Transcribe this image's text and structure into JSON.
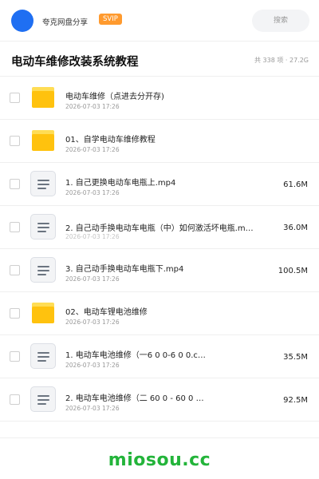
{
  "header": {
    "username": "夸克网盘分享",
    "badge": "SVIP",
    "search_placeholder": "搜索"
  },
  "page": {
    "title": "电动车维修改装系统教程",
    "meta": "共 338 项 · 27.2G"
  },
  "files": [
    {
      "type": "folder",
      "name": "电动车维修（点进去分开存)",
      "date": "2026-07-03 17:26",
      "size": ""
    },
    {
      "type": "folder",
      "name": "01、自学电动车维修教程",
      "date": "2026-07-03 17:26",
      "size": ""
    },
    {
      "type": "video",
      "name": "1. 自己更换电动车电瓶上.mp4",
      "date": "2026-07-03 17:26",
      "size": "61.6M"
    },
    {
      "type": "video",
      "name": "2. 自己动手换电动车电瓶（中）如何激活坏电瓶.m…",
      "date": "2026-07-03 17:26",
      "size": "36.0M"
    },
    {
      "type": "video",
      "name": "3. 自己动手换电动车电瓶下.mp4",
      "date": "2026-07-03 17:26",
      "size": "100.5M"
    },
    {
      "type": "folder",
      "name": "02、电动车锂电池维修",
      "date": "2026-07-03 17:26",
      "size": ""
    },
    {
      "type": "video",
      "name": "1. 电动车电池维修（一6 0 0-6 0 0.c…",
      "date": "2026-07-03 17:26",
      "size": "35.5M"
    },
    {
      "type": "video",
      "name": "2. 电动车电池维修（二 60 0 - 60 0 …",
      "date": "2026-07-03 17:26",
      "size": "92.5M"
    }
  ],
  "watermark": "miosou.cc"
}
